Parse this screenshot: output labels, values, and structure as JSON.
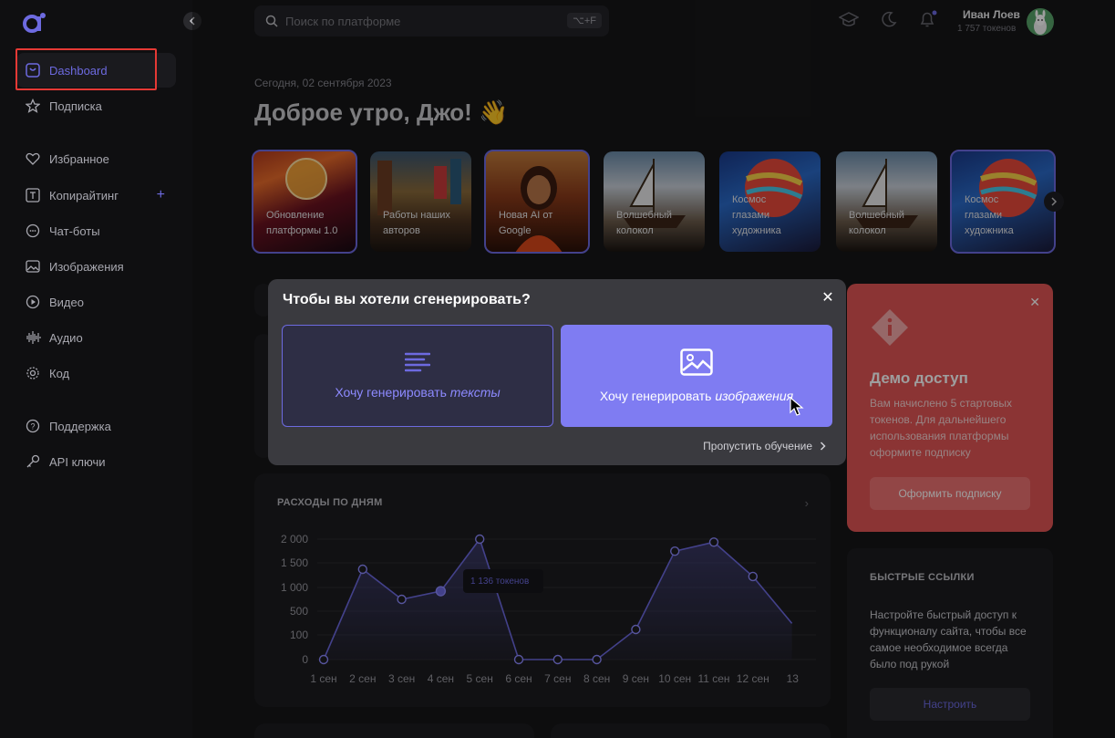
{
  "sidebar": {
    "collapse_icon": "chevron-left-icon",
    "items": [
      {
        "label": "Dashboard",
        "icon": "dashboard-icon",
        "active": true
      },
      {
        "label": "Подписка",
        "icon": "star-icon"
      },
      {
        "label": "Избранное",
        "icon": "heart-icon"
      },
      {
        "label": "Копирайтинг",
        "icon": "text-icon",
        "plus": "+"
      },
      {
        "label": "Чат-боты",
        "icon": "chat-icon"
      },
      {
        "label": "Изображения",
        "icon": "image-icon"
      },
      {
        "label": "Видео",
        "icon": "play-icon"
      },
      {
        "label": "Аудио",
        "icon": "audio-wave-icon"
      },
      {
        "label": "Код",
        "icon": "gear-icon"
      },
      {
        "label": "Поддержка",
        "icon": "help-icon"
      },
      {
        "label": "API ключи",
        "icon": "key-icon"
      }
    ]
  },
  "header": {
    "search_placeholder": "Поиск по платформе",
    "search_shortcut": "⌥+F",
    "user_name": "Иван Лоев",
    "user_tokens": "1 757 токенов"
  },
  "main": {
    "date": "Сегодня, 02 сентября 2023",
    "greeting": "Доброе утро, Джо! 👋"
  },
  "stories": [
    {
      "caption": "Обновление платформы 1.0",
      "selected": true
    },
    {
      "caption": "Работы наших авторов",
      "selected": false
    },
    {
      "caption": "Новая AI от Google",
      "selected": true
    },
    {
      "caption": "Волшебный колокол",
      "selected": false
    },
    {
      "caption": "Космос глазами художника",
      "selected": false
    },
    {
      "caption": "Волшебный колокол",
      "selected": false
    },
    {
      "caption": "Космос глазами художника",
      "selected": true
    }
  ],
  "modal": {
    "title": "Чтобы вы хотели сгенерировать?",
    "option_text_prefix": "Хочу генерировать ",
    "option_text_em": "тексты",
    "option_image_prefix": "Хочу генерировать ",
    "option_image_em": "изображения",
    "skip": "Пропустить обучение"
  },
  "demo": {
    "title": "Демо доступ",
    "text": "Вам начислено 5 стартовых токенов. Для дальнейшего использования платформы оформите подписку",
    "button": "Оформить подписку"
  },
  "quick_links": {
    "title": "БЫСТРЫЕ ССЫЛКИ",
    "text": "Настройте быстрый доступ к функционалу сайта, чтобы все самое необходимое всегда было под рукой",
    "button": "Настроить"
  },
  "chart_data": {
    "type": "area",
    "title": "РАСХОДЫ ПО ДНЯМ",
    "categories": [
      "1 сен",
      "2 сен",
      "3 сен",
      "4 сен",
      "5 сен",
      "6 сен",
      "7 сен",
      "8 сен",
      "9 сен",
      "10 сен",
      "11 сен",
      "12 сен",
      "13"
    ],
    "values": [
      0,
      1500,
      1000,
      1136,
      2000,
      0,
      0,
      0,
      500,
      1800,
      1950,
      1380,
      600
    ],
    "yticks": [
      "2 000",
      "1 500",
      "1 000",
      "500",
      "100",
      "0"
    ],
    "ylim": [
      0,
      2000
    ],
    "tooltip": "1 136 токенов",
    "accent": "#6d6ae0"
  }
}
